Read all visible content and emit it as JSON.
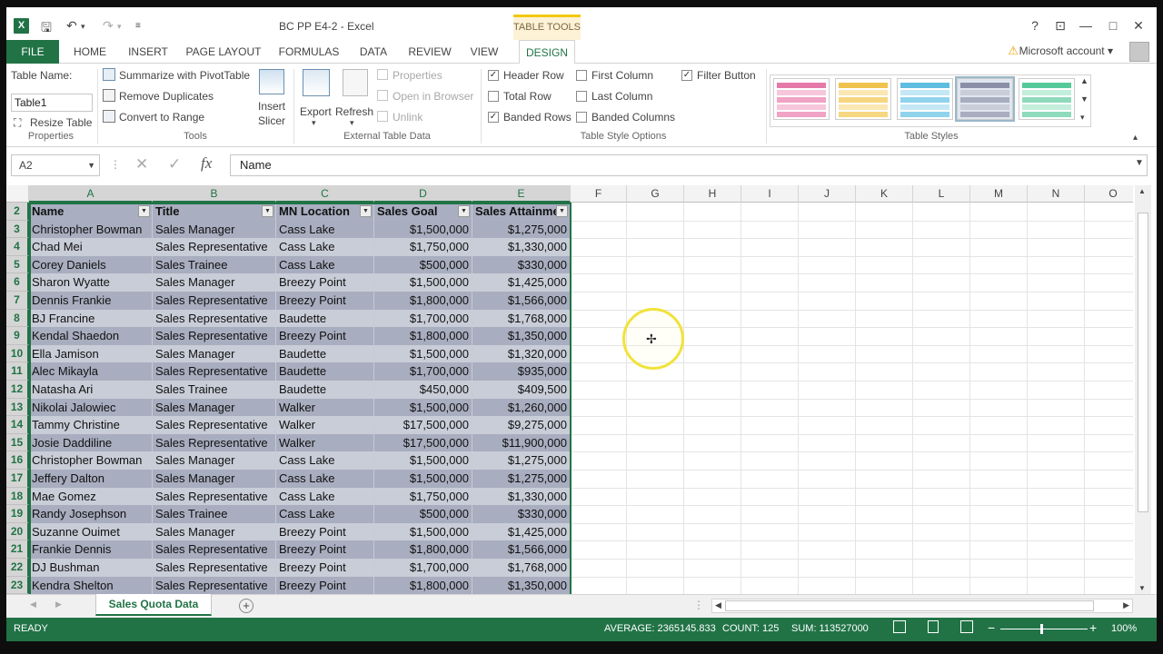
{
  "titlebar": {
    "doc_title": "BC PP E4-2 - Excel",
    "context_tab": "TABLE TOOLS",
    "help": "?",
    "restore_ribbon": "⊡",
    "minimize": "—",
    "maximize": "□",
    "close": "✕"
  },
  "tabs": {
    "file": "FILE",
    "home": "HOME",
    "insert": "INSERT",
    "page_layout": "PAGE LAYOUT",
    "formulas": "FORMULAS",
    "data": "DATA",
    "review": "REVIEW",
    "view": "VIEW",
    "design": "DESIGN",
    "account": "Microsoft account"
  },
  "ribbon": {
    "properties": {
      "table_name_label": "Table Name:",
      "table_name_value": "Table1",
      "resize_table": "Resize Table",
      "group": "Properties"
    },
    "tools": {
      "summarize": "Summarize with PivotTable",
      "remove_duplicates": "Remove Duplicates",
      "convert_to_range": "Convert to Range",
      "insert_slicer_1": "Insert",
      "insert_slicer_2": "Slicer",
      "group": "Tools"
    },
    "external": {
      "export": "Export",
      "refresh": "Refresh",
      "properties": "Properties",
      "open_in_browser": "Open in Browser",
      "unlink": "Unlink",
      "group": "External Table Data"
    },
    "style_options": {
      "header_row": "Header Row",
      "total_row": "Total Row",
      "banded_rows": "Banded Rows",
      "first_column": "First Column",
      "last_column": "Last Column",
      "banded_columns": "Banded Columns",
      "filter_button": "Filter Button",
      "group": "Table Style Options"
    },
    "table_styles": {
      "group": "Table Styles"
    }
  },
  "formula_bar": {
    "name_box": "A2",
    "fx": "fx",
    "content": "Name"
  },
  "columns": [
    "A",
    "B",
    "C",
    "D",
    "E",
    "F",
    "G",
    "H",
    "I",
    "J",
    "K",
    "L",
    "M",
    "N",
    "O"
  ],
  "table": {
    "headers": [
      "Name",
      "Title",
      "MN Location",
      "Sales Goal",
      "Sales Attainme"
    ],
    "rows": [
      {
        "n": "3",
        "c": [
          "Christopher Bowman",
          "Sales Manager",
          "Cass Lake",
          "$1,500,000",
          "$1,275,000"
        ]
      },
      {
        "n": "4",
        "c": [
          "Chad Mei",
          "Sales Representative",
          "Cass Lake",
          "$1,750,000",
          "$1,330,000"
        ]
      },
      {
        "n": "5",
        "c": [
          "Corey Daniels",
          "Sales Trainee",
          "Cass Lake",
          "$500,000",
          "$330,000"
        ]
      },
      {
        "n": "6",
        "c": [
          "Sharon Wyatte",
          "Sales Manager",
          "Breezy Point",
          "$1,500,000",
          "$1,425,000"
        ]
      },
      {
        "n": "7",
        "c": [
          "Dennis Frankie",
          "Sales Representative",
          "Breezy Point",
          "$1,800,000",
          "$1,566,000"
        ]
      },
      {
        "n": "8",
        "c": [
          "BJ Francine",
          "Sales Representative",
          "Baudette",
          "$1,700,000",
          "$1,768,000"
        ]
      },
      {
        "n": "9",
        "c": [
          "Kendal Shaedon",
          "Sales Representative",
          "Breezy Point",
          "$1,800,000",
          "$1,350,000"
        ]
      },
      {
        "n": "10",
        "c": [
          "Ella Jamison",
          "Sales Manager",
          "Baudette",
          "$1,500,000",
          "$1,320,000"
        ]
      },
      {
        "n": "11",
        "c": [
          "Alec Mikayla",
          "Sales Representative",
          "Baudette",
          "$1,700,000",
          "$935,000"
        ]
      },
      {
        "n": "12",
        "c": [
          "Natasha Ari",
          "Sales Trainee",
          "Baudette",
          "$450,000",
          "$409,500"
        ]
      },
      {
        "n": "13",
        "c": [
          "Nikolai Jalowiec",
          "Sales Manager",
          "Walker",
          "$1,500,000",
          "$1,260,000"
        ]
      },
      {
        "n": "14",
        "c": [
          "Tammy Christine",
          "Sales Representative",
          "Walker",
          "$17,500,000",
          "$9,275,000"
        ]
      },
      {
        "n": "15",
        "c": [
          "Josie Daddiline",
          "Sales Representative",
          "Walker",
          "$17,500,000",
          "$11,900,000"
        ]
      },
      {
        "n": "16",
        "c": [
          "Christopher Bowman",
          "Sales Manager",
          "Cass Lake",
          "$1,500,000",
          "$1,275,000"
        ]
      },
      {
        "n": "17",
        "c": [
          "Jeffery Dalton",
          "Sales Manager",
          "Cass Lake",
          "$1,500,000",
          "$1,275,000"
        ]
      },
      {
        "n": "18",
        "c": [
          "Mae Gomez",
          "Sales Representative",
          "Cass Lake",
          "$1,750,000",
          "$1,330,000"
        ]
      },
      {
        "n": "19",
        "c": [
          "Randy Josephson",
          "Sales Trainee",
          "Cass Lake",
          "$500,000",
          "$330,000"
        ]
      },
      {
        "n": "20",
        "c": [
          "Suzanne Ouimet",
          "Sales Manager",
          "Breezy Point",
          "$1,500,000",
          "$1,425,000"
        ]
      },
      {
        "n": "21",
        "c": [
          "Frankie Dennis",
          "Sales Representative",
          "Breezy Point",
          "$1,800,000",
          "$1,566,000"
        ]
      },
      {
        "n": "22",
        "c": [
          "DJ Bushman",
          "Sales Representative",
          "Breezy Point",
          "$1,700,000",
          "$1,768,000"
        ]
      },
      {
        "n": "23",
        "c": [
          "Kendra Shelton",
          "Sales Representative",
          "Breezy Point",
          "$1,800,000",
          "$1,350,000"
        ]
      }
    ]
  },
  "header_row_number": "2",
  "sheet_tab": "Sales Quota Data",
  "status": {
    "ready": "READY",
    "average": "AVERAGE: 2365145.833",
    "count": "COUNT: 125",
    "sum": "SUM: 113527000",
    "zoom": "100%"
  },
  "colors": {
    "accent": "#217346",
    "band_dark": "#a8adbf",
    "band_light": "#c9cdd8"
  }
}
